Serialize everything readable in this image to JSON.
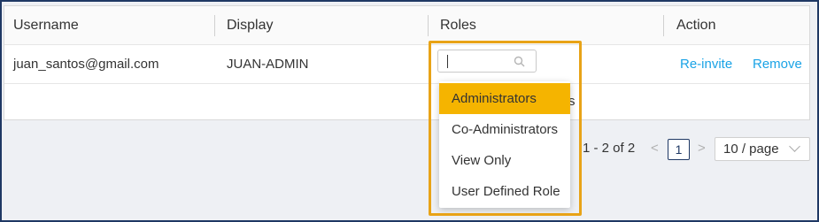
{
  "table": {
    "columns": [
      "Username",
      "Display",
      "Roles",
      "Action"
    ],
    "rows": [
      {
        "username": "juan_santos@gmail.com",
        "display": "JUAN-ADMIN",
        "actions": [
          "Re-invite",
          "Remove"
        ]
      }
    ],
    "partial_text": "s"
  },
  "roles_dropdown": {
    "input_value": "",
    "options": [
      "Administrators",
      "Co-Administrators",
      "View Only",
      "User Defined Role"
    ],
    "selected_index": 0
  },
  "pagination": {
    "total_text": "1 - 2 of 2",
    "prev_glyph": "<",
    "next_glyph": ">",
    "current_page": "1",
    "page_size": "10 / page"
  },
  "colors": {
    "frame_border": "#1f3864",
    "highlight": "#e8a317",
    "selected_option": "#f5b400",
    "link": "#1aa3e6"
  },
  "icons": {
    "roles_search": "search-icon",
    "page_size_toggle": "chevron-down-icon"
  }
}
